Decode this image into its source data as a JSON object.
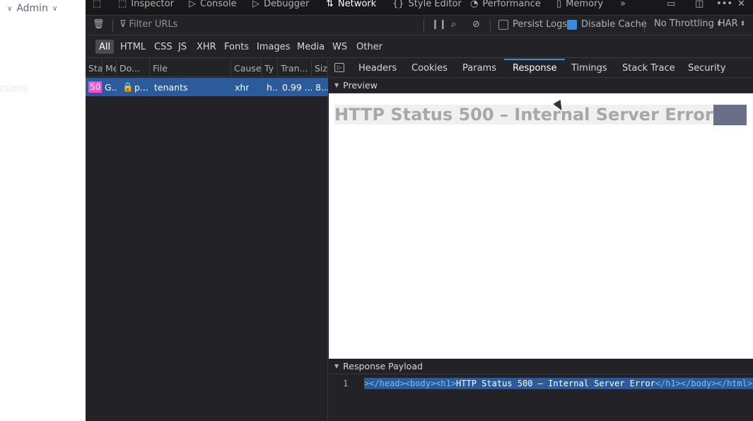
{
  "app": {
    "admin_label": "Admin",
    "ghost_text": "ctions"
  },
  "devtools_tabs": [
    {
      "label": "Inspector",
      "icon": "inspector-icon"
    },
    {
      "label": "Console",
      "icon": "console-icon"
    },
    {
      "label": "Debugger",
      "icon": "debugger-icon"
    },
    {
      "label": "Network",
      "icon": "network-icon",
      "active": true
    },
    {
      "label": "Style Editor",
      "icon": "style-editor-icon"
    },
    {
      "label": "Performance",
      "icon": "performance-icon"
    },
    {
      "label": "Memory",
      "icon": "memory-icon"
    }
  ],
  "toolbar": {
    "filter_placeholder": "Filter URLs",
    "persist_logs_label": "Persist Logs",
    "persist_logs_checked": false,
    "disable_cache_label": "Disable Cache",
    "disable_cache_checked": true,
    "throttling_label": "No Throttling",
    "har_label": "HAR"
  },
  "type_filters": [
    "All",
    "HTML",
    "CSS",
    "JS",
    "XHR",
    "Fonts",
    "Images",
    "Media",
    "WS",
    "Other"
  ],
  "request_columns": [
    "Sta",
    "Me",
    "Do...",
    "File",
    "Cause",
    "Ty",
    "Tran...",
    "Siz"
  ],
  "request_rows": [
    {
      "status": "50",
      "method": "G...",
      "domain": "p...",
      "file": "tenants",
      "cause": "xhr",
      "type": "h...",
      "transferred": "0.99 ...",
      "size": "8..."
    }
  ],
  "details_tabs": [
    "Headers",
    "Cookies",
    "Params",
    "Response",
    "Timings",
    "Stack Trace",
    "Security"
  ],
  "details_active_tab": "Response",
  "preview": {
    "section_label": "Preview",
    "heading": "HTTP Status 500 – Internal Server Error"
  },
  "payload": {
    "section_label": "Response Payload",
    "line_number": "1",
    "code_prefix": "></head><body><h1>",
    "code_text": "HTTP Status 500 – Internal Server Error",
    "code_suffix": "</h1></body></html>"
  },
  "colors": {
    "devtools_bg": "#232327",
    "selected_row": "#2b5b9a",
    "status_500_badge": "#ff4bd8",
    "accent": "#3a8cdb"
  }
}
